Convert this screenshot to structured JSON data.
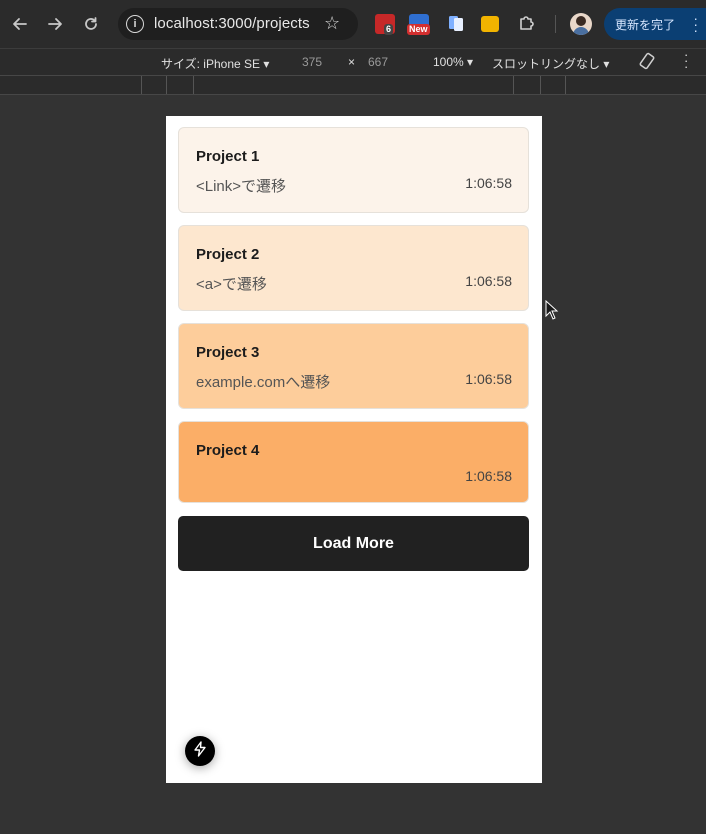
{
  "browser": {
    "url": "localhost:3000/projects",
    "ext_badge_1": "6",
    "ext_badge_2": "New",
    "update_label": "更新を完了"
  },
  "device_toolbar": {
    "size_label": "サイズ: iPhone SE ▾",
    "width": "375",
    "times": "×",
    "height": "667",
    "zoom": "100% ▾",
    "throttle": "スロットリングなし ▾"
  },
  "projects": [
    {
      "title": "Project 1",
      "desc": "<Link>で遷移",
      "time": "1:06:58",
      "color": "#fcf3ea"
    },
    {
      "title": "Project 2",
      "desc": "<a>で遷移",
      "time": "1:06:58",
      "color": "#fde7cf"
    },
    {
      "title": "Project 3",
      "desc": "example.comへ遷移",
      "time": "1:06:58",
      "color": "#fdcd9b"
    },
    {
      "title": "Project 4",
      "desc": "",
      "time": "1:06:58",
      "color": "#fbae67"
    }
  ],
  "load_more_label": "Load More",
  "colors": {
    "chrome_bg": "#2b2b2b",
    "page_bg": "#333333",
    "button_bg": "#212121",
    "update_btn": "#0b3f73"
  },
  "icons": [
    "back-arrow-icon",
    "forward-arrow-icon",
    "reload-icon",
    "site-info-icon",
    "bookmark-star-icon",
    "extensions-puzzle-icon",
    "rotate-icon",
    "kebab-menu-icon",
    "lightning-bolt-icon"
  ]
}
